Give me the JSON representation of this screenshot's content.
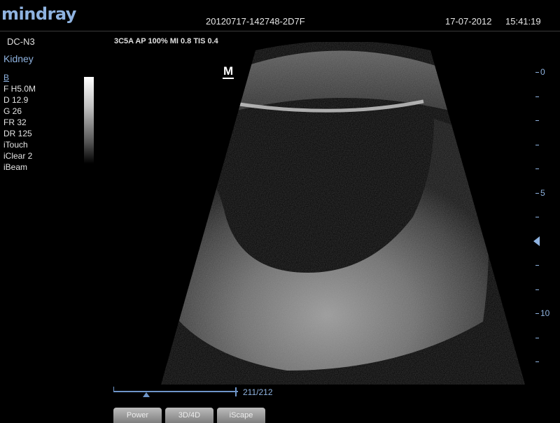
{
  "header": {
    "logo": "mindray",
    "exam_id": "20120717-142748-2D7F",
    "date": "17-07-2012",
    "time": "15:41:19"
  },
  "left_panel": {
    "probe": "DC-N3",
    "exam_type": "Kidney",
    "params": [
      "B",
      "F H5.0M",
      "D 12.9",
      "G 26",
      "FR 32",
      "DR 125",
      "iTouch",
      "iClear 2",
      "iBeam"
    ]
  },
  "acquisition": "3C5A  AP 100%  MI 0.8  TIS 0.4",
  "image": {
    "orientation_marker": "M"
  },
  "depth_scale": {
    "labels": [
      {
        "text": "0",
        "value": 0
      },
      {
        "text": "5",
        "value": 5
      },
      {
        "text": "10",
        "value": 10
      }
    ],
    "tick_count": 13,
    "focus_depth": 7
  },
  "cine": {
    "current_frame": 211,
    "total_frames": 212,
    "label": "211/212"
  },
  "softkeys": [
    "Power",
    "3D/4D",
    "iScape"
  ]
}
